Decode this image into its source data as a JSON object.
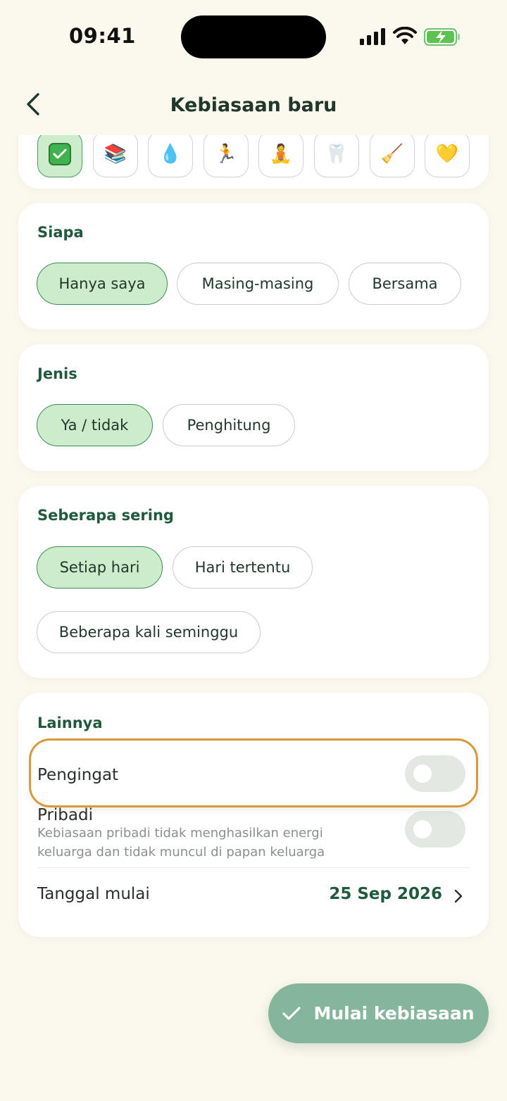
{
  "status": {
    "time": "09:41"
  },
  "nav": {
    "title": "Kebiasaan baru"
  },
  "emoji_picker": {
    "items": [
      {
        "glyph": "",
        "icon": "check-box-icon",
        "selected": true
      },
      {
        "glyph": "📚",
        "icon": "books-icon"
      },
      {
        "glyph": "💧",
        "icon": "water-drop-icon"
      },
      {
        "glyph": "🏃",
        "icon": "runner-icon"
      },
      {
        "glyph": "🧘",
        "icon": "meditation-icon"
      },
      {
        "glyph": "🦷",
        "icon": "tooth-icon"
      },
      {
        "glyph": "🧹",
        "icon": "broom-icon"
      },
      {
        "glyph": "💛",
        "icon": "yellow-heart-icon"
      }
    ]
  },
  "who": {
    "title": "Siapa",
    "options": [
      "Hanya saya",
      "Masing-masing",
      "Bersama"
    ],
    "selected": "Hanya saya"
  },
  "type": {
    "title": "Jenis",
    "options": [
      "Ya / tidak",
      "Penghitung"
    ],
    "selected": "Ya / tidak"
  },
  "frequency": {
    "title": "Seberapa sering",
    "options": [
      "Setiap hari",
      "Hari tertentu",
      "Beberapa kali seminggu"
    ],
    "selected": "Setiap hari"
  },
  "other": {
    "title": "Lainnya",
    "reminder": {
      "label": "Pengingat",
      "on": false
    },
    "private": {
      "label": "Pribadi",
      "description": "Kebiasaan pribadi tidak menghasilkan energi keluarga dan tidak muncul di papan keluarga",
      "on": false
    },
    "start_date": {
      "label": "Tanggal mulai",
      "value": "25 Sep 2026"
    }
  },
  "cta": {
    "label": "Mulai kebiasaan"
  },
  "colors": {
    "background": "#fbf8ee",
    "accent_green": "#1f5a3d",
    "selected_fill": "#cdeccb",
    "cta": "#85b59b",
    "highlight": "#d79a3a"
  }
}
